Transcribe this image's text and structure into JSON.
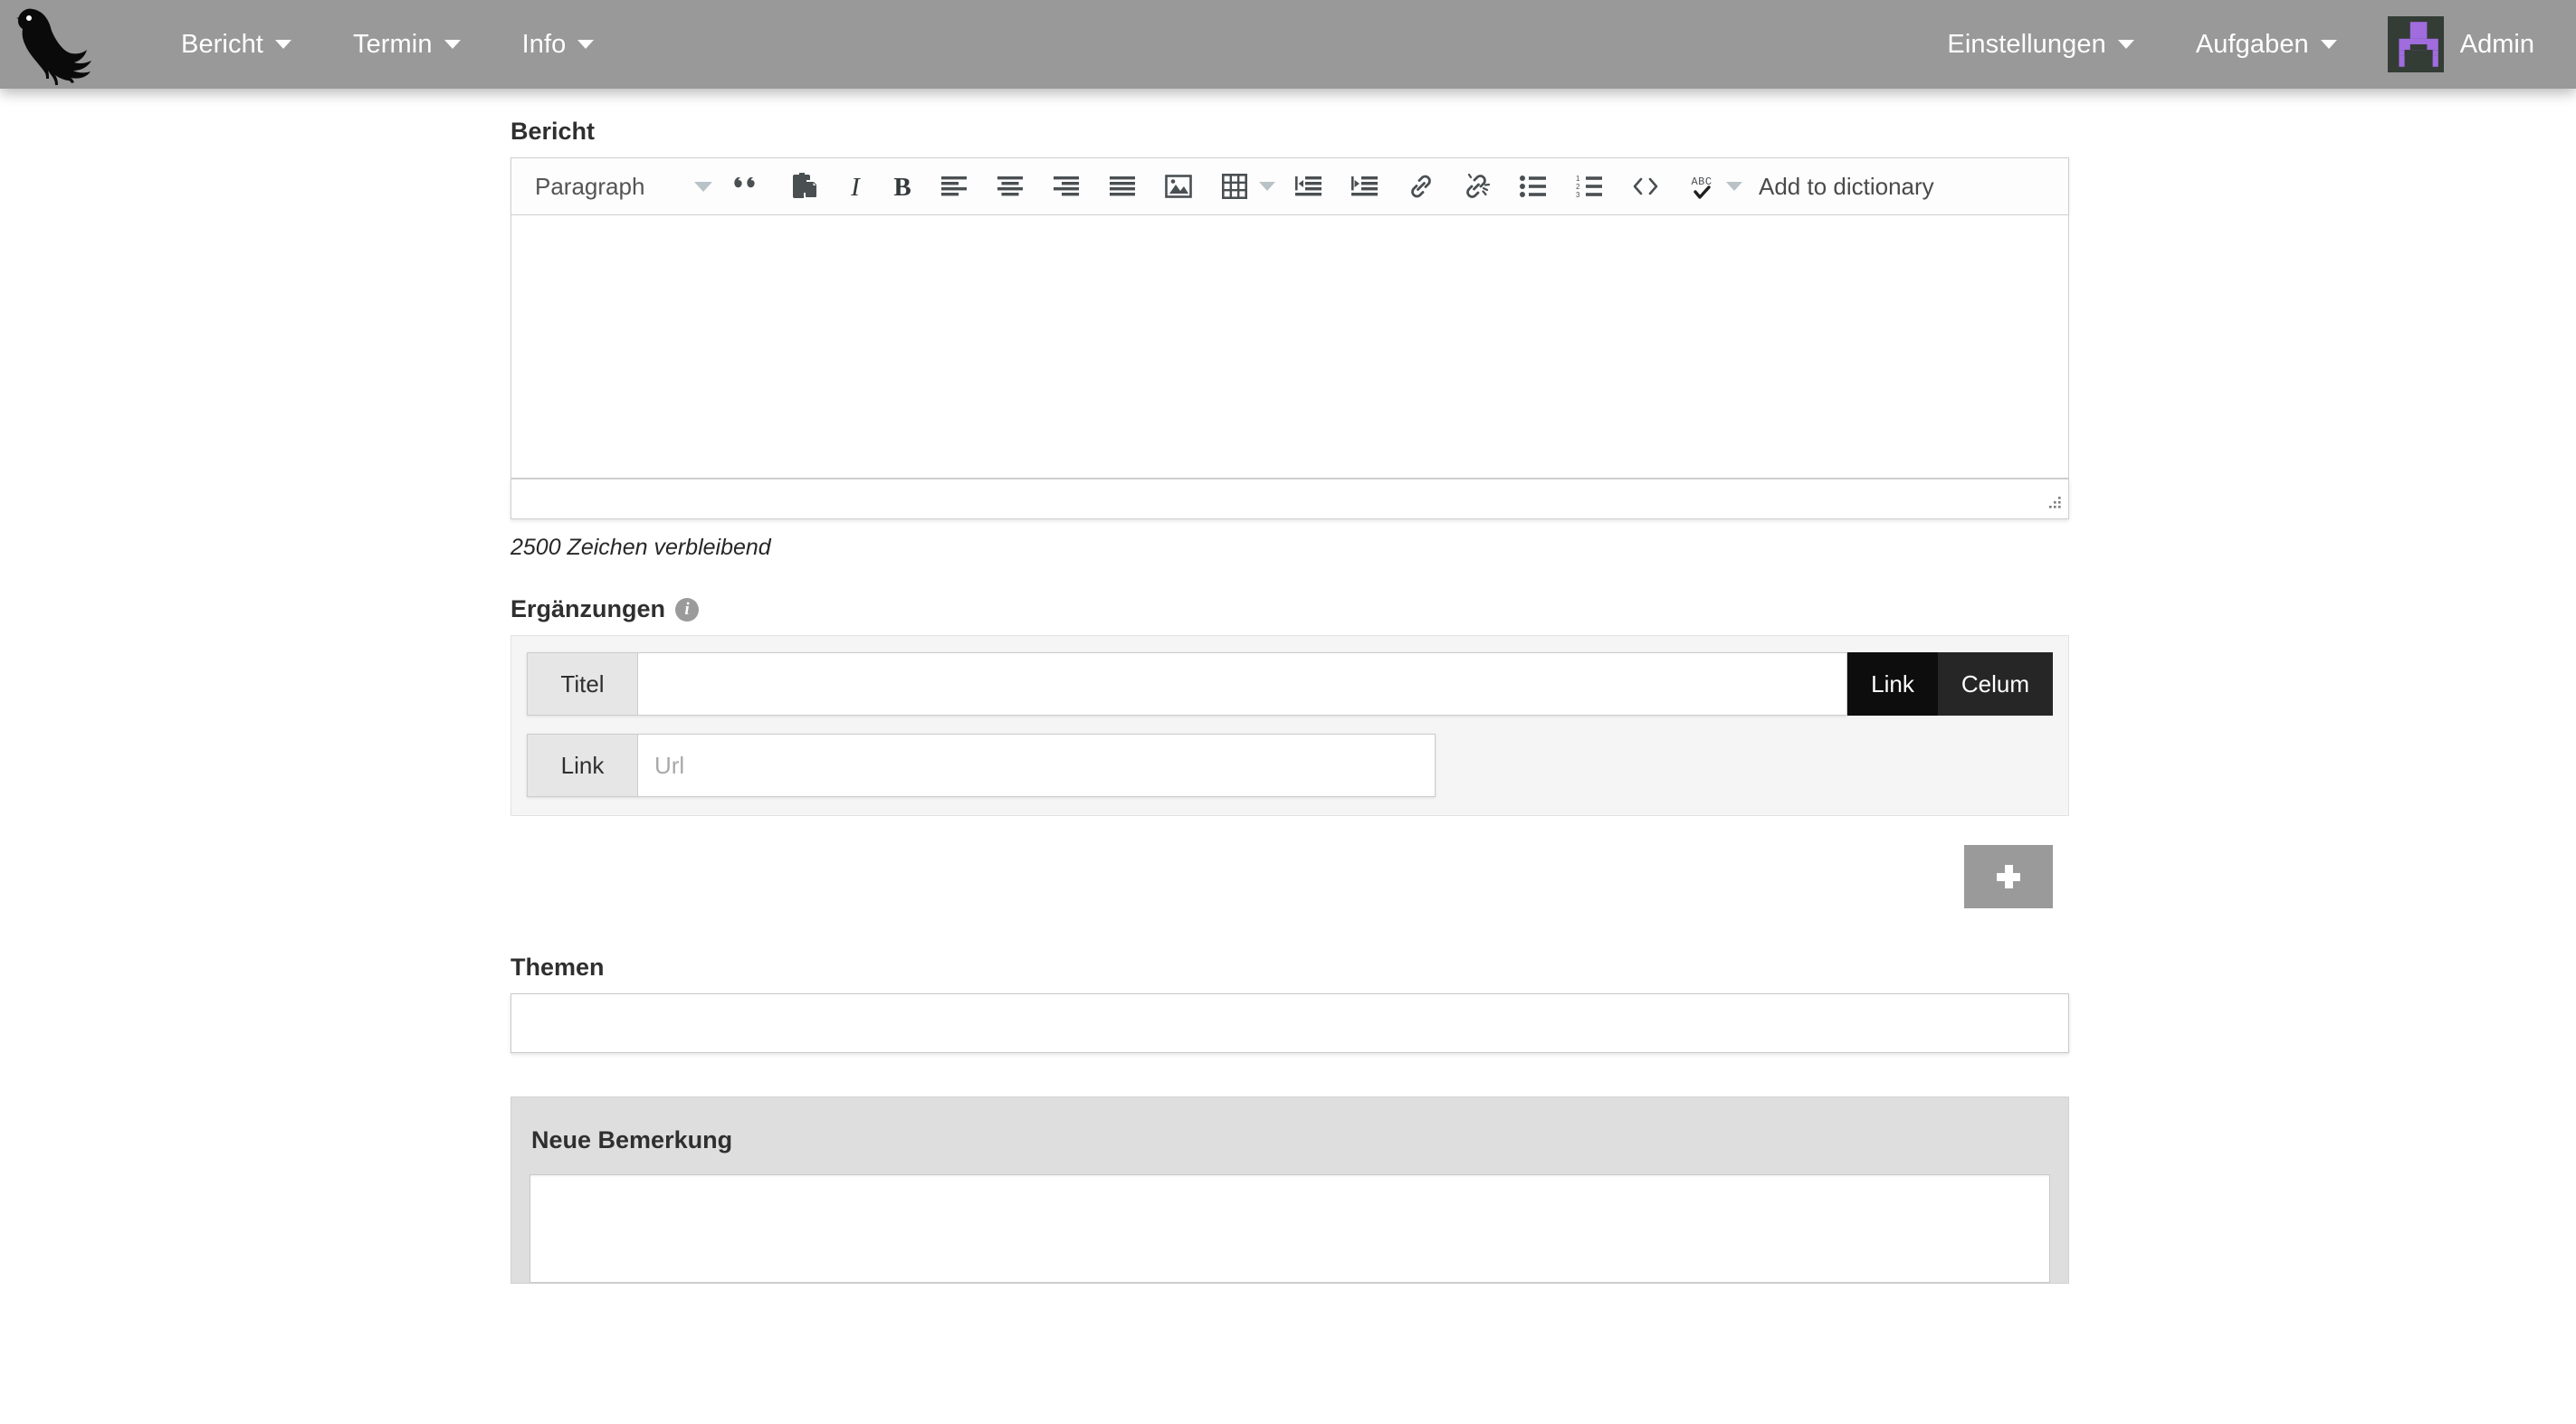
{
  "navbar": {
    "logo_name": "raven-logo",
    "left_items": [
      {
        "label": "Bericht",
        "has_caret": true
      },
      {
        "label": "Termin",
        "has_caret": true
      },
      {
        "label": "Info",
        "has_caret": true
      }
    ],
    "right_items": [
      {
        "label": "Einstellungen",
        "has_caret": true
      },
      {
        "label": "Aufgaben",
        "has_caret": true
      }
    ],
    "user": {
      "name": "Admin",
      "avatar_bg": "#333c35",
      "avatar_fg": "#a06cde"
    },
    "background": "#999999",
    "text_color": "#ffffff"
  },
  "report": {
    "label": "Bericht",
    "toolbar": {
      "style_select": {
        "value": "Paragraph",
        "icon": "chevron-down-icon"
      },
      "buttons": [
        {
          "name": "blockquote-icon",
          "title": "Blockquote"
        },
        {
          "name": "paste-icon",
          "title": "Paste"
        },
        {
          "name": "italic-icon",
          "title": "Italic"
        },
        {
          "name": "bold-icon",
          "title": "Bold"
        },
        {
          "name": "align-left-icon",
          "title": "Align left"
        },
        {
          "name": "align-center-icon",
          "title": "Align center"
        },
        {
          "name": "align-right-icon",
          "title": "Align right"
        },
        {
          "name": "align-justify-icon",
          "title": "Justify"
        },
        {
          "name": "image-icon",
          "title": "Insert image"
        },
        {
          "name": "table-icon",
          "title": "Table"
        },
        {
          "name": "outdent-icon",
          "title": "Decrease indent"
        },
        {
          "name": "indent-icon",
          "title": "Increase indent"
        },
        {
          "name": "link-icon",
          "title": "Insert link"
        },
        {
          "name": "unlink-icon",
          "title": "Remove link"
        },
        {
          "name": "bullet-list-icon",
          "title": "Bullet list"
        },
        {
          "name": "numbered-list-icon",
          "title": "Numbered list"
        },
        {
          "name": "source-code-icon",
          "title": "Source code"
        },
        {
          "name": "spellcheck-icon",
          "title": "Spell check"
        }
      ],
      "add_to_dictionary": "Add to dictionary"
    },
    "body_value": "",
    "char_count": "2500 Zeichen verbleibend"
  },
  "ergaenzungen": {
    "label": "Ergänzungen",
    "info_icon": "info-icon",
    "rows": [
      {
        "addon": "Titel",
        "value": "",
        "placeholder": "",
        "buttons": [
          {
            "label": "Link",
            "color": "#0d0d0d",
            "active": true
          },
          {
            "label": "Celum",
            "color": "#262626",
            "active": false
          }
        ]
      },
      {
        "addon": "Link",
        "value": "",
        "placeholder": "Url",
        "buttons": []
      }
    ],
    "add_button": {
      "name": "add-row-button",
      "icon": "plus-icon",
      "color": "#9a9a9a"
    }
  },
  "themen": {
    "label": "Themen",
    "value": "",
    "placeholder": ""
  },
  "bemerkung": {
    "title": "Neue Bemerkung",
    "value": "",
    "placeholder": ""
  }
}
